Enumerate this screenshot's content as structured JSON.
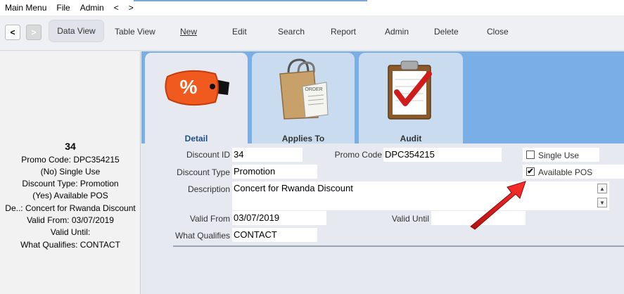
{
  "menu": {
    "items": [
      "Main Menu",
      "File",
      "Admin"
    ],
    "back": "<",
    "forward": ">"
  },
  "toolbar": {
    "nav_back": "<",
    "nav_forward": ">",
    "data_view": "Data View",
    "table_view": "Table View",
    "new": "New",
    "edit": "Edit",
    "search": "Search",
    "report": "Report",
    "admin": "Admin",
    "delete": "Delete",
    "close": "Close"
  },
  "summary": {
    "id": "34",
    "lines": [
      "Promo Code: DPC354215",
      "(No) Single Use",
      "Discount Type: Promotion",
      "(Yes) Available POS",
      "De..: Concert for Rwanda Discount",
      "Valid From: 03/07/2019",
      "Valid Until:",
      "What Qualifies: CONTACT"
    ]
  },
  "tabs": [
    {
      "label": "Detail",
      "active": true,
      "icon": "discount-tag-icon"
    },
    {
      "label": "Applies To",
      "active": false,
      "icon": "shopping-bag-icon"
    },
    {
      "label": "Audit",
      "active": false,
      "icon": "clipboard-check-icon"
    }
  ],
  "form": {
    "discount_id_label": "Discount ID",
    "discount_id": "34",
    "promo_code_label": "Promo Code",
    "promo_code": "DPC354215",
    "discount_type_label": "Discount Type",
    "discount_type": "Promotion",
    "description_label": "Description",
    "description": "Concert for Rwanda Discount",
    "valid_from_label": "Valid From",
    "valid_from": "03/07/2019",
    "valid_until_label": "Valid Until",
    "valid_until": "",
    "what_qualifies_label": "What Qualifies",
    "what_qualifies": "CONTACT",
    "single_use_label": "Single Use",
    "single_use": false,
    "available_pos_label": "Available POS",
    "available_pos": true,
    "checkmark": "✔"
  },
  "colors": {
    "tabstrip": "#7aaee6",
    "arrow": "#e01b1b",
    "active_tab_label": "#1f4f8a"
  }
}
